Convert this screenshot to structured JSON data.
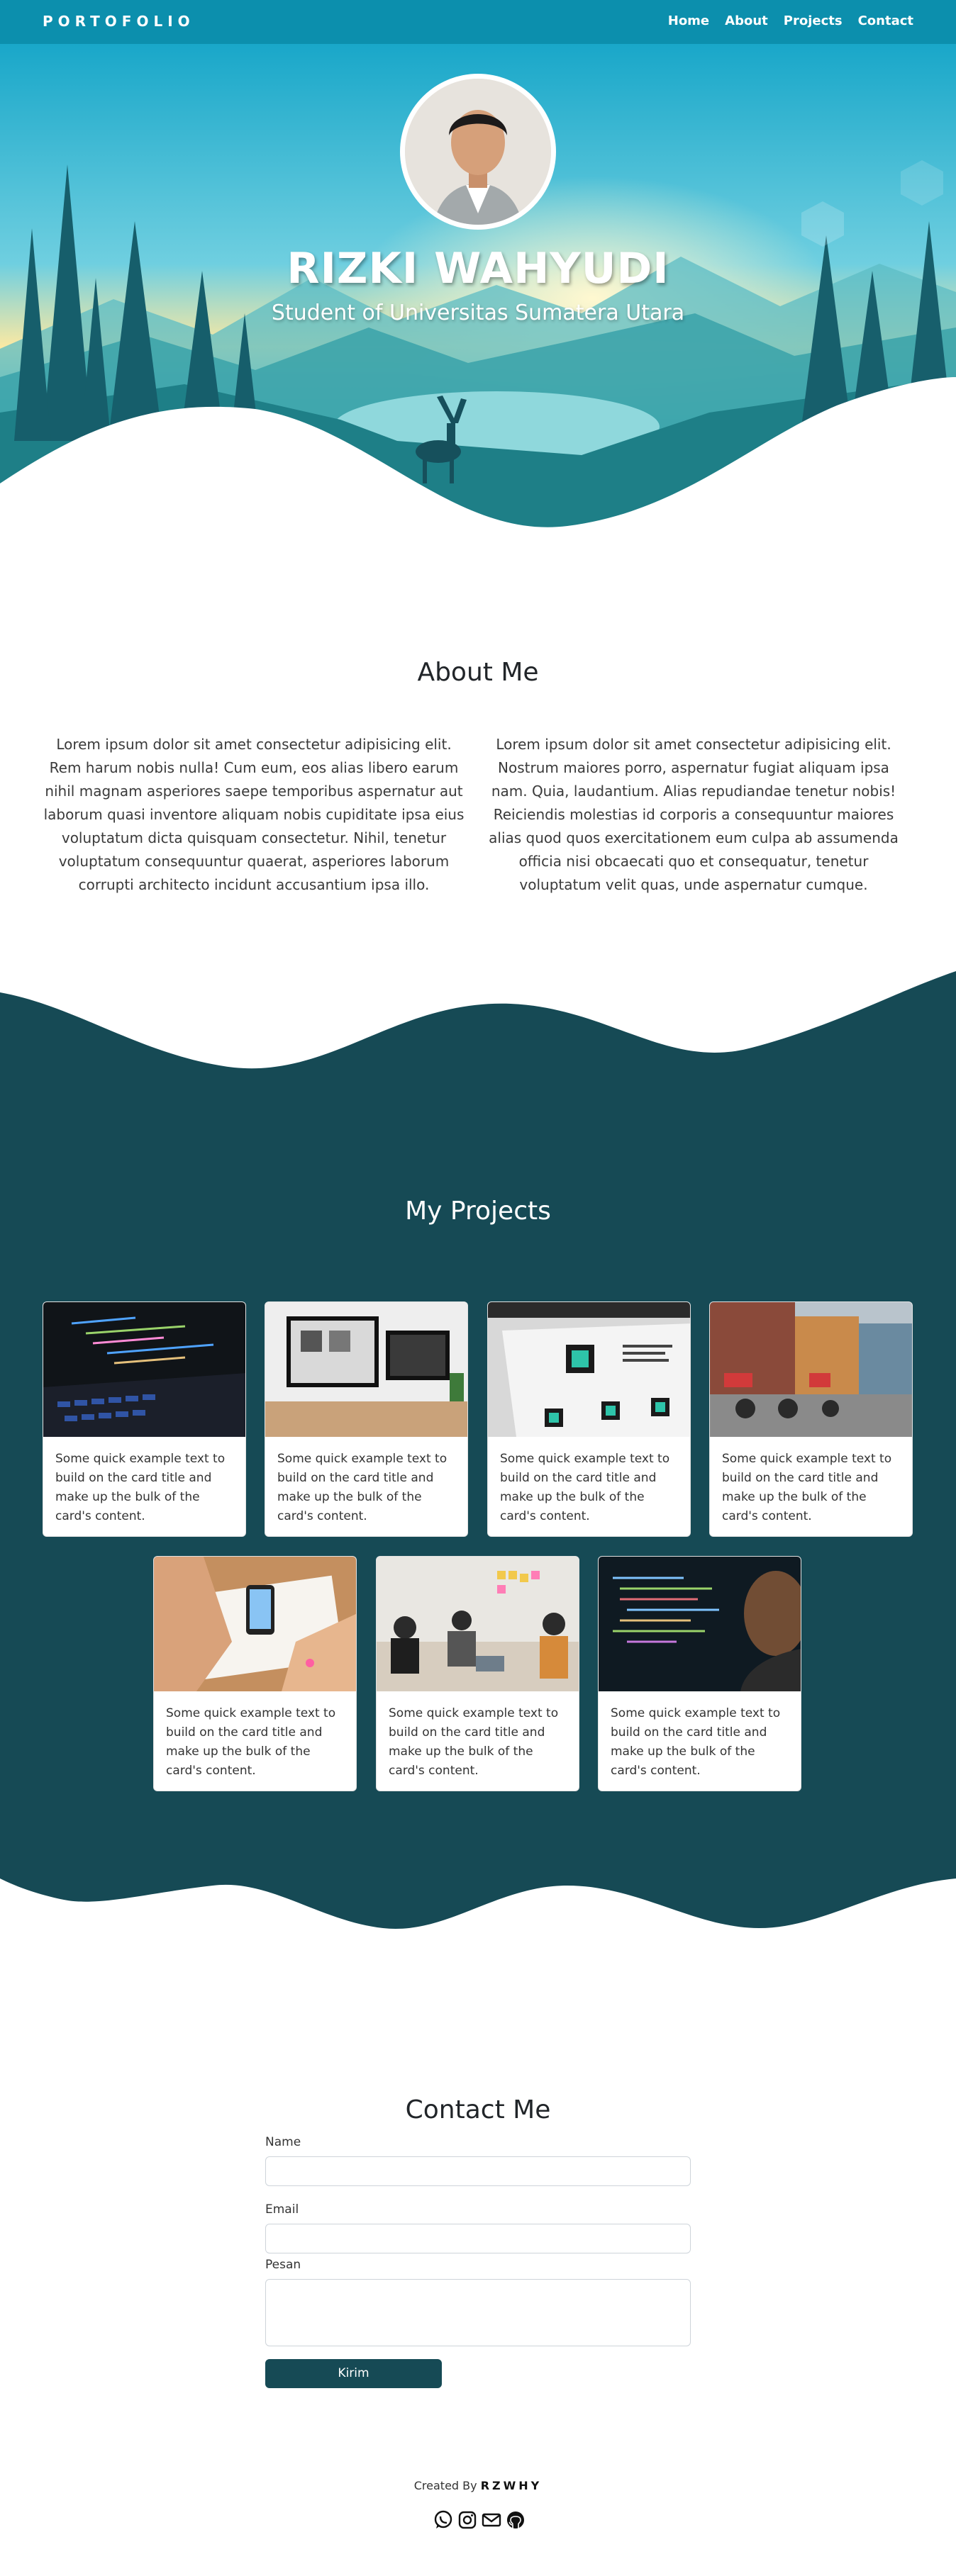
{
  "navbar": {
    "brand": "PORTOFOLIO",
    "links": [
      "Home",
      "About",
      "Projects",
      "Contact"
    ]
  },
  "hero": {
    "name": "RIZKI WAHYUDI",
    "subtitle": "Student of Universitas Sumatera Utara"
  },
  "about": {
    "title": "About Me",
    "left_text": "Lorem ipsum dolor sit amet consectetur adipisicing elit. Rem harum nobis nulla! Cum eum, eos alias libero earum nihil magnam asperiores saepe temporibus aspernatur aut laborum quasi inventore aliquam nobis cupiditate ipsa eius voluptatum dicta quisquam consectetur. Nihil, tenetur voluptatum consequuntur quaerat, asperiores laborum corrupti architecto incidunt accusantium ipsa illo.",
    "right_text": "Lorem ipsum dolor sit amet consectetur adipisicing elit. Nostrum maiores porro, aspernatur fugiat aliquam ipsa nam. Quia, laudantium. Alias repudiandae tenetur nobis! Reiciendis molestias id corporis a consequuntur maiores alias quod quos exercitationem eum culpa ab assumenda officia nisi obcaecati quo et consequatur, tenetur voluptatum velit quas, unde aspernatur cumque."
  },
  "projects": {
    "title": "My Projects",
    "cards": [
      {
        "image": "laptop-code-photo",
        "text": "Some quick example text to build on the card title and make up the bulk of the card's content."
      },
      {
        "image": "desk-monitors-photo",
        "text": "Some quick example text to build on the card title and make up the bulk of the card's content."
      },
      {
        "image": "website-mockup-photo",
        "text": "Some quick example text to build on the card title and make up the bulk of the card's content."
      },
      {
        "image": "street-market-photo",
        "text": "Some quick example text to build on the card title and make up the bulk of the card's content."
      },
      {
        "image": "design-sketch-photo",
        "text": "Some quick example text to build on the card title and make up the bulk of the card's content."
      },
      {
        "image": "team-meeting-photo",
        "text": "Some quick example text to build on the card title and make up the bulk of the card's content."
      },
      {
        "image": "developer-code-photo",
        "text": "Some quick example text to build on the card title and make up the bulk of the card's content."
      }
    ]
  },
  "contact": {
    "title": "Contact Me",
    "name_label": "Name",
    "email_label": "Email",
    "message_label": "Pesan",
    "submit_label": "Kirim"
  },
  "footer": {
    "created_by": "Created By",
    "author": "RZWHY",
    "social_icons": [
      "whatsapp-icon",
      "instagram-icon",
      "email-icon",
      "github-icon"
    ]
  },
  "colors": {
    "navbar": "#0c8fad",
    "dark_teal": "#164a55",
    "button": "#164a55"
  }
}
